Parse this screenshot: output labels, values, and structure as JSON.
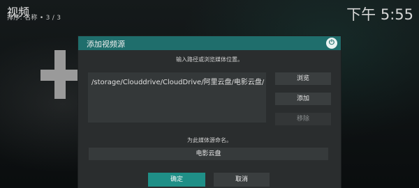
{
  "header": {
    "title": "视频",
    "subtitle": "排序: 名称  •  3 / 3",
    "clock": "下午 5:55"
  },
  "dialog": {
    "title": "添加视频源",
    "close_icon": "power-icon",
    "path_hint": "输入路径或浏览媒体位置。",
    "path_value": "/storage/Clouddrive/CloudDrive/阿里云盘/电影云盘/",
    "buttons": {
      "browse": "浏览",
      "add": "添加",
      "remove": "移除"
    },
    "name_hint": "为此媒体源命名。",
    "name_value": "电影云盘",
    "ok": "确定",
    "cancel": "取消"
  },
  "colors": {
    "accent": "#1f6e6c",
    "ok_button": "#1f8f87"
  }
}
